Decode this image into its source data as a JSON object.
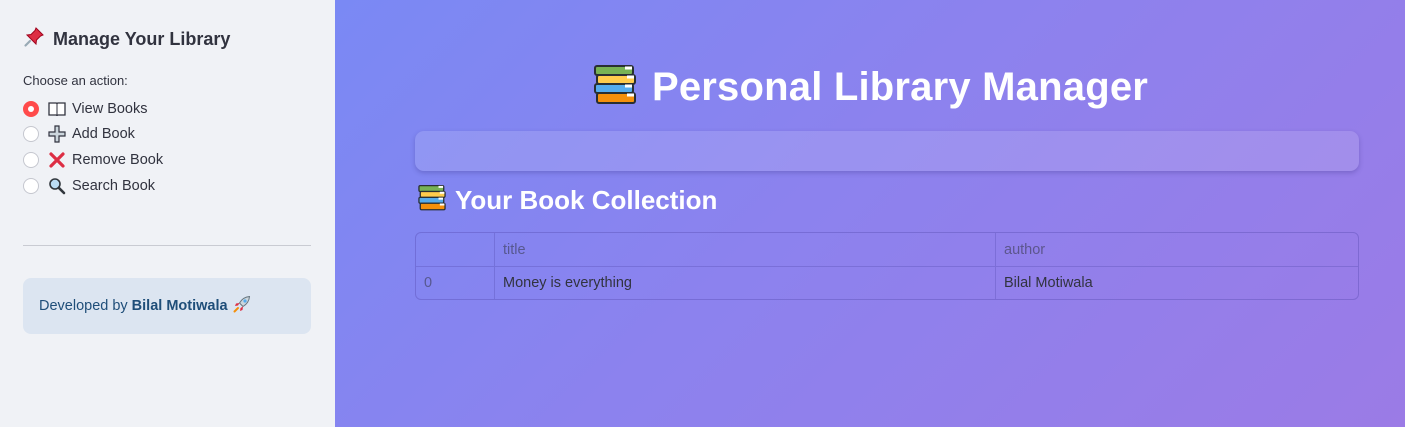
{
  "sidebar": {
    "header": "Manage Your Library",
    "header_icon": "pushpin-icon",
    "caption": "Choose an action:",
    "options": [
      {
        "label": "View Books",
        "icon": "open-book-icon",
        "selected": true
      },
      {
        "label": "Add Book",
        "icon": "plus-icon",
        "selected": false
      },
      {
        "label": "Remove Book",
        "icon": "cross-mark-icon",
        "selected": false
      },
      {
        "label": "Search Book",
        "icon": "magnifier-icon",
        "selected": false
      }
    ],
    "credit": {
      "prefix": "Developed by",
      "name": "Bilal Motiwala",
      "icon": "rocket-icon"
    }
  },
  "main": {
    "title": "Personal Library Manager",
    "title_icon": "books-icon",
    "section_title": "Your Book Collection",
    "table": {
      "columns": [
        "",
        "title",
        "author"
      ],
      "rows": [
        {
          "index": "0",
          "title": "Money is everything",
          "author": "Bilal Motiwala"
        }
      ]
    }
  },
  "colors": {
    "accent": "#ff4b4b",
    "sidebar_bg": "#f0f2f6",
    "gradient_start": "#7a89f4",
    "gradient_end": "#9b7be6",
    "credit_bg": "#dce5f1"
  }
}
